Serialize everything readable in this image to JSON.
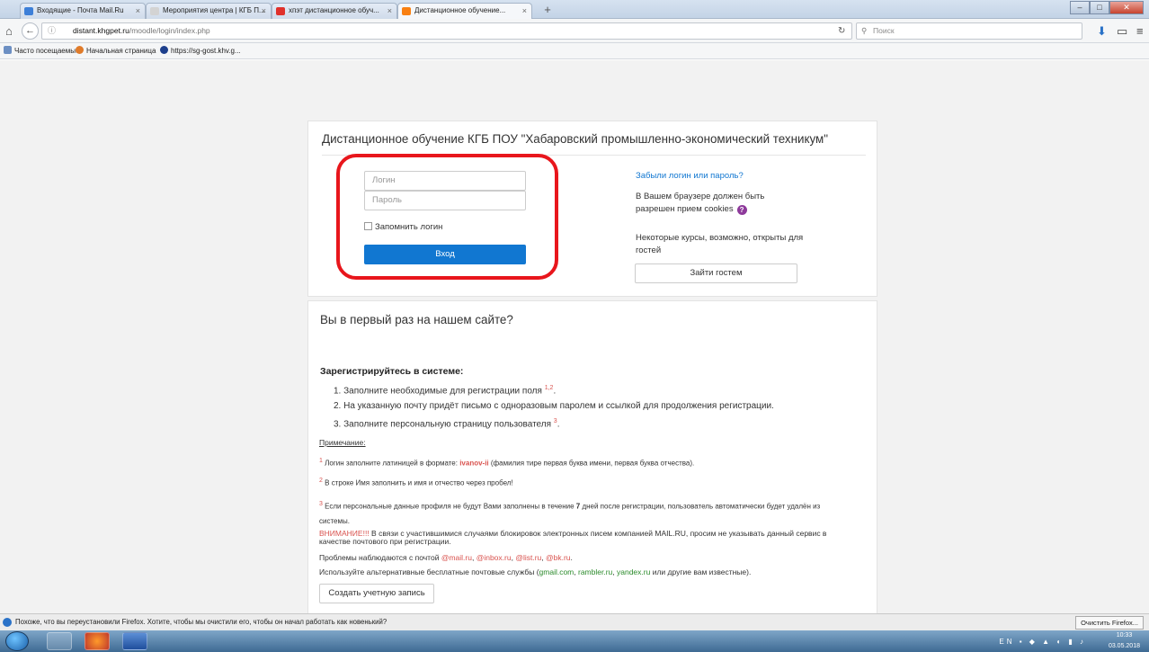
{
  "browser": {
    "tabs": [
      {
        "title": "Входящие - Почта Mail.Ru",
        "icon": "mail-icon",
        "color": "#3d7fd8"
      },
      {
        "title": "Мероприятия центра | КГБ П...",
        "icon": "page-icon",
        "color": "#d3d3d3"
      },
      {
        "title": "хпэт дистанционное обуч...",
        "icon": "yandex-icon",
        "color": "#e0312b"
      },
      {
        "title": "Дистанционное обучение...",
        "icon": "moodle-icon",
        "color": "#f98012"
      }
    ],
    "url_host": "distant.khgpet.ru",
    "url_path": "/moodle/login/index.php",
    "search_placeholder": "Поиск",
    "bookmarks": [
      "Часто посещаемые",
      "Начальная страница",
      "https://sg-gost.khv.g..."
    ]
  },
  "login": {
    "site_title": "Дистанционное обучение КГБ ПОУ \"Хабаровский промышленно-экономический техникум\"",
    "username_placeholder": "Логин",
    "password_placeholder": "Пароль",
    "remember_label": "Запомнить логин",
    "login_button": "Вход",
    "forgot_link": "Забыли логин или пароль?",
    "cookies_text": "В Вашем браузере должен быть разрешен прием cookies",
    "guests_text": "Некоторые курсы, возможно, открыты для гостей",
    "guest_button": "Зайти гостем"
  },
  "signup": {
    "heading": "Вы в первый раз на нашем сайте?",
    "subheading": "Зарегистрируйтесь в системе:",
    "steps": [
      {
        "text": "1. Заполните необходимые для регистрации поля",
        "sup": "1,2"
      },
      {
        "text": "2. На указанную почту придёт письмо с одноразовым паролем и ссылкой для продолжения регистрации.",
        "sup": ""
      },
      {
        "text": "3. Заполните персональную страницу пользователя",
        "sup": "3"
      }
    ],
    "note_label": "Примечание:",
    "note1": {
      "mark": "1",
      "pre": "Логин заполните латиницей в формате:",
      "example": "ivanov-ii",
      "post": "(фамилия тире первая буква имени, первая буква отчества)."
    },
    "note2": {
      "mark": "2",
      "text": "В строке Имя заполнить и имя и отчество через пробел!"
    },
    "note3": {
      "mark": "3",
      "pre": "Если персональные данные профиля не будут Вами заполнены в течение",
      "days": "7",
      "post": "дней после регистрации, пользователь автоматически будет удалён из системы."
    },
    "warning": {
      "label": "ВНИМАНИЕ!!!",
      "text": "В связи с участившимися случаями блокировок электронных писем компанией MAIL.RU, просим не указывать данный сервис в качестве почтового при регистрации."
    },
    "problems": {
      "text": "Проблемы наблюдаются с почтой",
      "domains": [
        "@mail.ru",
        "@inbox.ru",
        "@list.ru",
        "@bk.ru"
      ]
    },
    "alternatives": {
      "pre": "Используйте альтернативные бесплатные почтовые службы (",
      "services": [
        "gmail.com",
        "rambler.ru",
        "yandex.ru"
      ],
      "post": "или другие вам известные)."
    },
    "create_button": "Создать учетную запись"
  },
  "notification": {
    "text": "Похоже, что вы переустановили Firefox. Хотите, чтобы мы очистили его, чтобы он начал работать как новенький?",
    "button": "Очистить Firefox..."
  },
  "taskbar": {
    "lang": "EN",
    "time": "10:33",
    "date": "03.05.2018"
  }
}
